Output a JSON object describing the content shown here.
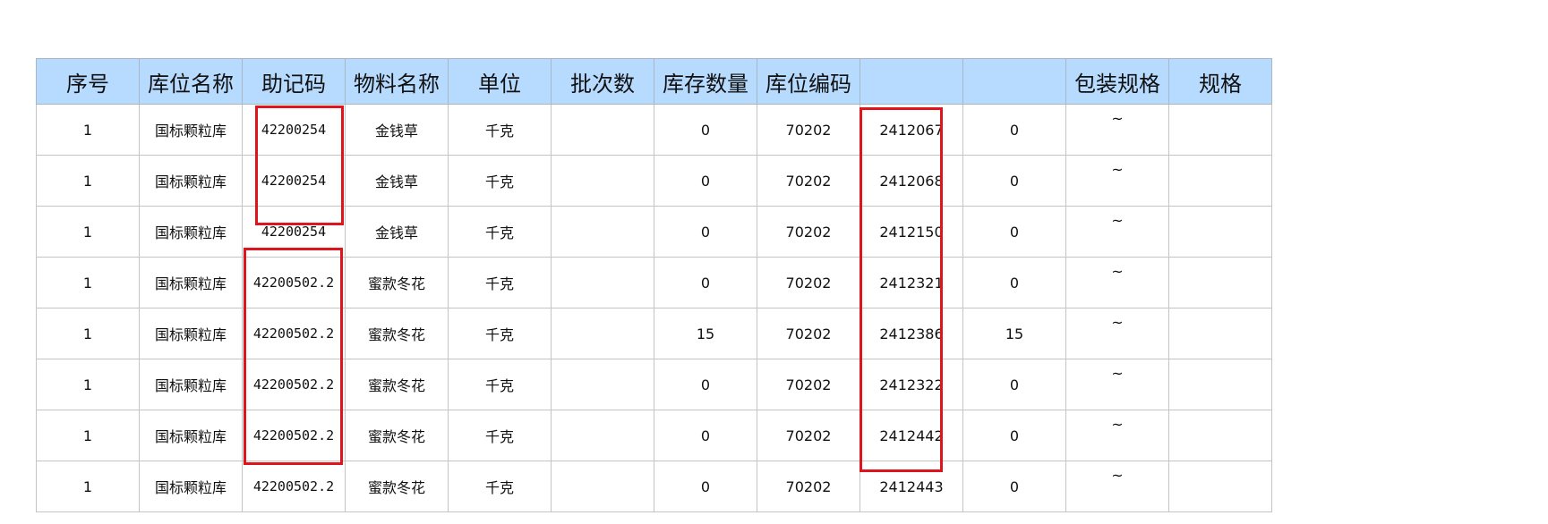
{
  "table": {
    "headers": [
      "序号",
      "库位名称",
      "助记码",
      "物料名称",
      "单位",
      "批次数",
      "库存数量",
      "库位编码",
      "",
      "",
      "包装规格",
      "规格"
    ],
    "rows": [
      [
        "1",
        "国标颗粒库",
        "42200254",
        "金钱草",
        "千克",
        "",
        "0",
        "70202",
        "2412067",
        "0",
        "~",
        ""
      ],
      [
        "1",
        "国标颗粒库",
        "42200254",
        "金钱草",
        "千克",
        "",
        "0",
        "70202",
        "2412068",
        "0",
        "~",
        ""
      ],
      [
        "1",
        "国标颗粒库",
        "42200254",
        "金钱草",
        "千克",
        "",
        "0",
        "70202",
        "2412150",
        "0",
        "~",
        ""
      ],
      [
        "1",
        "国标颗粒库",
        "42200502.2",
        "蜜款冬花",
        "千克",
        "",
        "0",
        "70202",
        "2412321",
        "0",
        "~",
        ""
      ],
      [
        "1",
        "国标颗粒库",
        "42200502.2",
        "蜜款冬花",
        "千克",
        "",
        "15",
        "70202",
        "2412386",
        "15",
        "~",
        ""
      ],
      [
        "1",
        "国标颗粒库",
        "42200502.2",
        "蜜款冬花",
        "千克",
        "",
        "0",
        "70202",
        "2412322",
        "0",
        "~",
        ""
      ],
      [
        "1",
        "国标颗粒库",
        "42200502.2",
        "蜜款冬花",
        "千克",
        "",
        "0",
        "70202",
        "2412442",
        "0",
        "~",
        ""
      ],
      [
        "1",
        "国标颗粒库",
        "42200502.2",
        "蜜款冬花",
        "千克",
        "",
        "0",
        "70202",
        "2412443",
        "0",
        "~",
        ""
      ]
    ]
  },
  "colors": {
    "header_background": "#b7dbff",
    "grid_line": "#c4c4c4",
    "highlight_box": "#e0141c"
  }
}
